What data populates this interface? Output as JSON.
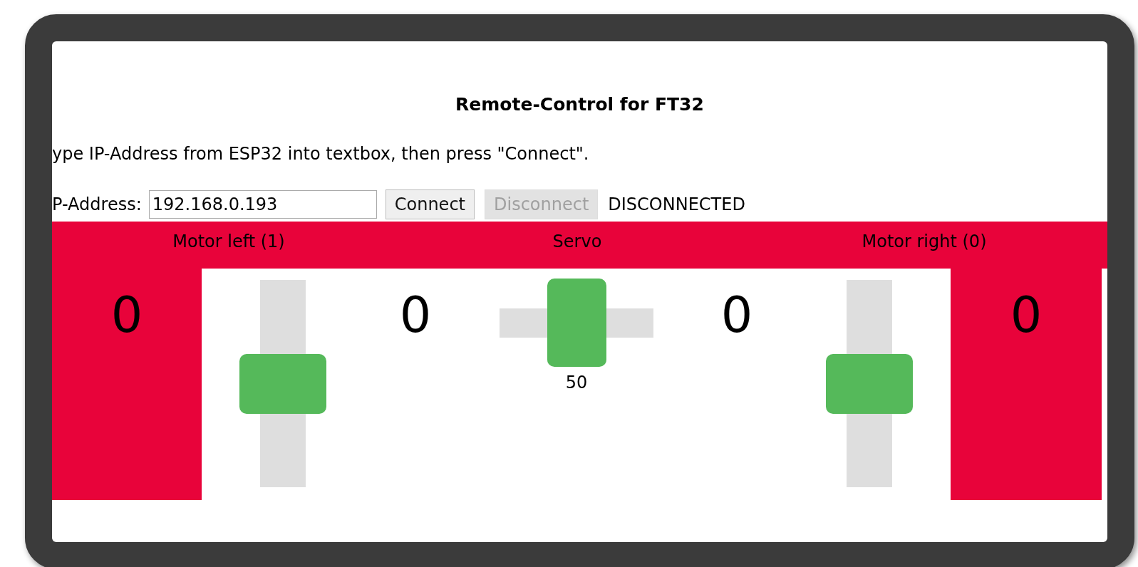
{
  "title": "Remote-Control for FT32",
  "instruction": "ype IP-Address from ESP32 into textbox, then press \"Connect\".",
  "ip_label": "P-Address:",
  "ip_field": {
    "value": "192.168.0.193"
  },
  "buttons": [
    {
      "label": "Connect",
      "disabled": false
    },
    {
      "label": "Disconnect",
      "disabled": true
    }
  ],
  "status": "DISCONNECTED",
  "band_labels": [
    "Motor left (1)",
    "Servo",
    "Motor right (0)"
  ],
  "columns": [
    {
      "kind": "panel-readout",
      "value": "0"
    },
    {
      "kind": "vslider",
      "level": 0.5
    },
    {
      "kind": "readout",
      "value": "0"
    },
    {
      "kind": "hslider",
      "level": 0.5,
      "reading": "50"
    },
    {
      "kind": "readout",
      "value": "0"
    },
    {
      "kind": "vslider",
      "level": 0.5
    },
    {
      "kind": "panel-readout",
      "value": "0"
    }
  ]
}
